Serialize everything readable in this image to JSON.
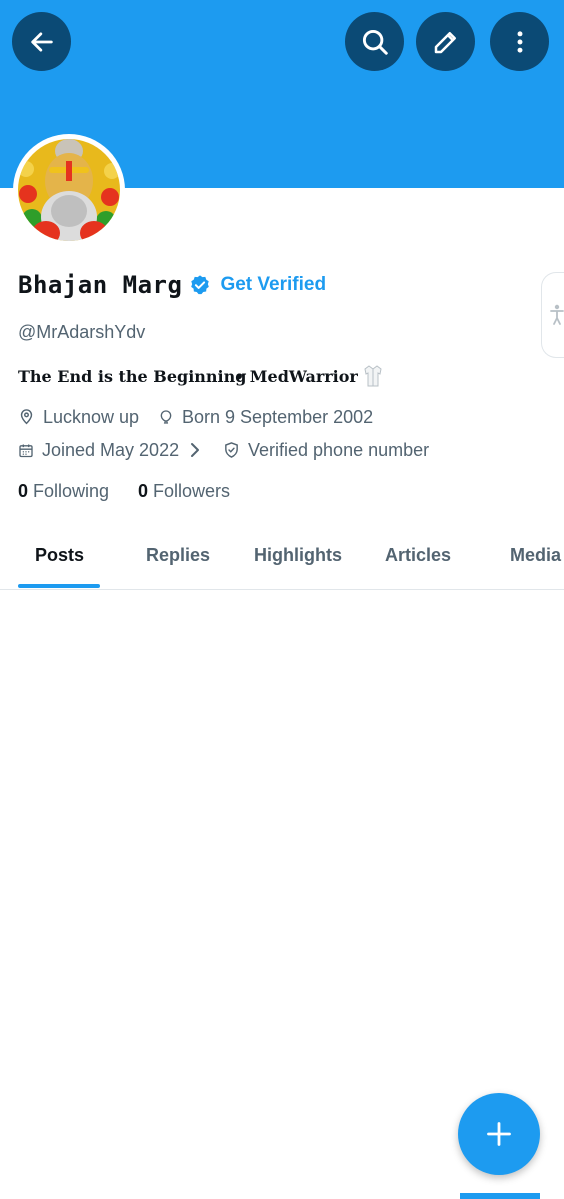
{
  "profile": {
    "display_name": "Bhajan Marg",
    "get_verified_label": "Get Verified",
    "handle": "@MrAdarshYdv",
    "bio_main": "The End is the Beginning",
    "bio_tag": "• MedWarrior",
    "location": "Lucknow up",
    "birthday": "Born 9 September 2002",
    "joined": "Joined May 2022",
    "verified_phone": "Verified phone number",
    "following_count": "0",
    "following_label": "Following",
    "followers_count": "0",
    "followers_label": "Followers"
  },
  "tabs": [
    {
      "label": "Posts",
      "active": true
    },
    {
      "label": "Replies",
      "active": false
    },
    {
      "label": "Highlights",
      "active": false
    },
    {
      "label": "Articles",
      "active": false
    },
    {
      "label": "Media",
      "active": false
    }
  ],
  "icons": {
    "back": "arrow-left-icon",
    "search": "search-icon",
    "edit": "pencil-icon",
    "more": "more-vertical-icon",
    "location": "location-pin-icon",
    "birthday": "balloon-icon",
    "calendar": "calendar-icon",
    "verified_phone": "shield-check-icon",
    "compose": "plus-icon",
    "accessibility": "accessibility-icon"
  },
  "colors": {
    "banner": "#1d9bf0",
    "header_button": "#0b4a75",
    "accent": "#1d9bf0",
    "primary_text": "#0f1419",
    "secondary_text": "#536471"
  }
}
